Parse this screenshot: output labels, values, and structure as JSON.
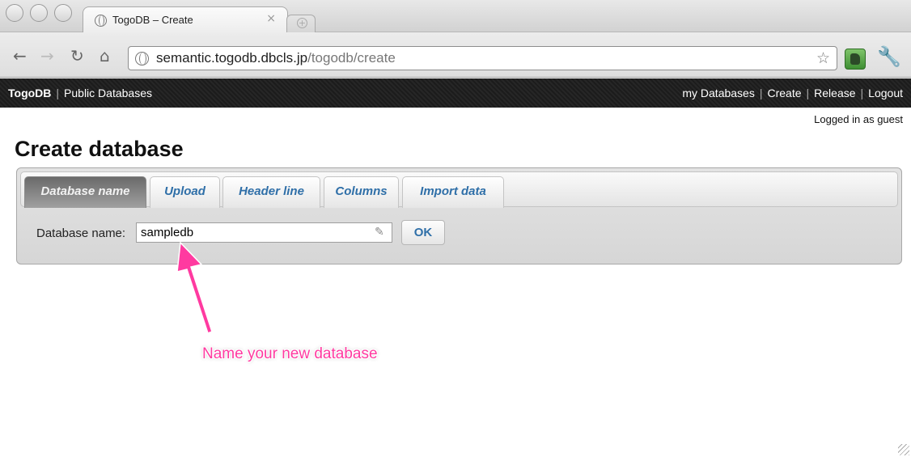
{
  "browser": {
    "tab_title": "TogoDB – Create",
    "tab_close": "×",
    "url_host": "semantic.togodb.dbcls.jp",
    "url_path": "/togodb/create"
  },
  "site": {
    "brand": "TogoDB",
    "separator": "|",
    "public_databases": "Public Databases",
    "nav": [
      "my Databases",
      "Create",
      "Release",
      "Logout"
    ],
    "login_status": "Logged in as guest"
  },
  "page": {
    "title": "Create database",
    "tabs": [
      "Database name",
      "Upload",
      "Header line",
      "Columns",
      "Import data"
    ],
    "active_tab": "Database name",
    "field_label": "Database name:",
    "field_value": "sampledb",
    "ok_label": "OK",
    "annotation": "Name your new database",
    "annotation_color": "#ff3aa0"
  },
  "colors": {
    "link_blue": "#2f6fa8",
    "navbar": "#1c1c1c"
  }
}
